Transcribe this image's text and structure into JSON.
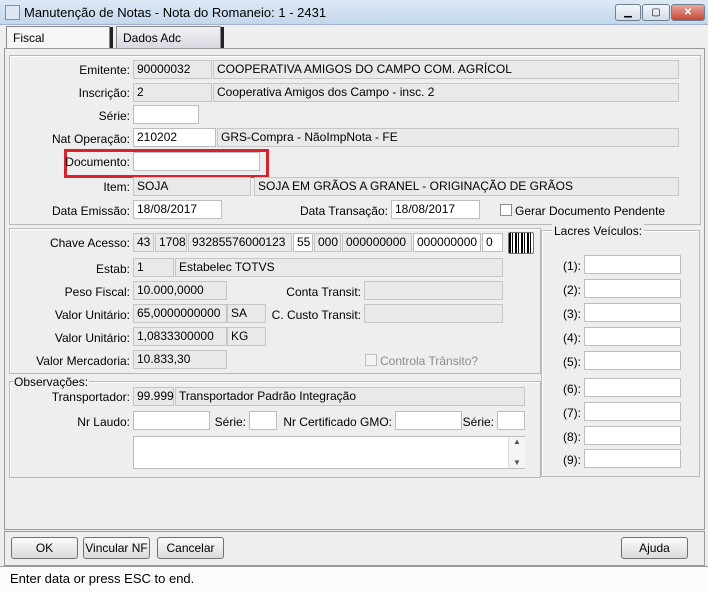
{
  "window": {
    "title": "Manutenção de Notas - Nota do Romaneio: 1 - 2431",
    "min_label": "▁",
    "max_label": "▢",
    "close_label": "✕"
  },
  "tabs": [
    {
      "label": "Fiscal"
    },
    {
      "label": "Dados Adc"
    }
  ],
  "top": {
    "emitente_label": "Emitente:",
    "emitente_code": "90000032",
    "emitente_name": "COOPERATIVA AMIGOS DO CAMPO COM. AGRÍCOL",
    "inscricao_label": "Inscrição:",
    "inscricao_code": "2",
    "inscricao_name": "Cooperativa Amigos dos Campo - insc. 2",
    "serie_label": "Série:",
    "serie_value": "",
    "natop_label": "Nat Operação:",
    "natop_code": "210202",
    "natop_desc": "GRS-Compra - NãoImpNota - FE",
    "documento_label": "Documento:",
    "documento_value": "",
    "item_label": "Item:",
    "item_code": "SOJA",
    "item_desc": "SOJA EM GRÃOS A GRANEL - ORIGINAÇÃO DE GRÃOS",
    "data_emissao_label": "Data Emissão:",
    "data_emissao_value": "18/08/2017",
    "data_transacao_label": "Data Transação:",
    "data_transacao_value": "18/08/2017",
    "gerar_doc_label": "Gerar Documento Pendente"
  },
  "mid": {
    "chave_label": "Chave Acesso:",
    "chave_parts": [
      "43",
      "1708",
      "93285576000123",
      "55",
      "000",
      "000000000",
      "000000000",
      "0"
    ],
    "barcode_icon": "barcode-icon",
    "estab_label": "Estab:",
    "estab_code": "1",
    "estab_name": "Estabelec TOTVS",
    "peso_label": "Peso Fiscal:",
    "peso_value": "10.000,0000",
    "conta_label": "Conta Transit:",
    "conta_value": "",
    "vu1_label": "Valor Unitário:",
    "vu1_value": "65,0000000000",
    "vu1_unit": "SA",
    "ccusto_label": "C. Custo Transit:",
    "ccusto_value": "",
    "vu2_label": "Valor Unitário:",
    "vu2_value": "1,0833300000",
    "vu2_unit": "KG",
    "vm_label": "Valor Mercadoria:",
    "vm_value": "10.833,30",
    "controla_label": "Controla Trânsito?"
  },
  "obs": {
    "group_label": "Observações:",
    "transportador_label": "Transportador:",
    "transportador_code": "99.999",
    "transportador_name": "Transportador Padrão Integração",
    "nr_laudo_label": "Nr Laudo:",
    "serie1_label": "Série:",
    "nr_cert_label": "Nr Certificado GMO:",
    "serie2_label": "Série:",
    "text_value": ""
  },
  "lacres": {
    "group_label": "Lacres Veículos:",
    "items": [
      {
        "label": "(1):"
      },
      {
        "label": "(2):"
      },
      {
        "label": "(3):"
      },
      {
        "label": "(4):"
      },
      {
        "label": "(5):"
      },
      {
        "label": "(6):"
      },
      {
        "label": "(7):"
      },
      {
        "label": "(8):"
      },
      {
        "label": "(9):"
      }
    ]
  },
  "buttons": {
    "ok": "OK",
    "vincular": "Vincular NF",
    "cancelar": "Cancelar",
    "ajuda": "Ajuda"
  },
  "status_text": "Enter data or press ESC to end."
}
